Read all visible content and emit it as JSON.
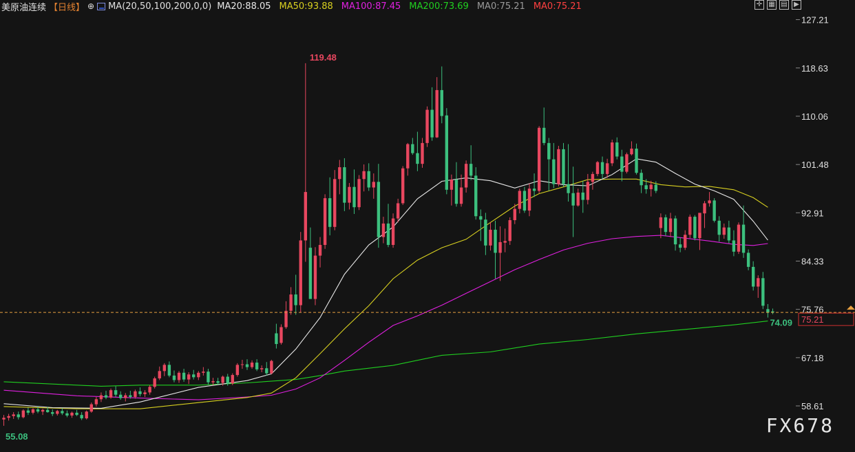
{
  "header": {
    "instrument": "美原油连续",
    "period": "【日线】",
    "ma_params": "MA(20,50,100,200,0,0)",
    "ma_values": [
      {
        "label": "MA20:88.05",
        "color": "#e8e8e8"
      },
      {
        "label": "MA50:93.88",
        "color": "#d8d020"
      },
      {
        "label": "MA100:87.45",
        "color": "#e020e0"
      },
      {
        "label": "MA200:73.69",
        "color": "#20d020"
      },
      {
        "label": "MA0:75.21",
        "color": "#9a9a9a"
      },
      {
        "label": "MA0:75.21",
        "color": "#ff4040"
      }
    ],
    "tools": [
      "crosshair-icon",
      "grid-icon",
      "bars-icon",
      "play-icon"
    ]
  },
  "watermark": "FX678",
  "colors": {
    "background": "#141414",
    "up": "#e8475f",
    "down": "#3cc07e",
    "ma20": "#e8e8e8",
    "ma50": "#d8d020",
    "ma100": "#e020e0",
    "ma200": "#20d020",
    "price_line": "#e8a040"
  },
  "chart_data": {
    "type": "candlestick",
    "y_axis_ticks": [
      "127.21",
      "118.63",
      "110.06",
      "101.48",
      "92.91",
      "84.33",
      "75.76",
      "67.18",
      "58.61"
    ],
    "ylim": [
      52.5,
      128.5
    ],
    "annotations": {
      "max_label": "119.48",
      "min_label": "55.08",
      "ma200_label": "74.09",
      "last_price": "75.21"
    },
    "candles": [
      [
        56.2,
        57.0,
        55.08,
        56.5
      ],
      [
        56.5,
        57.2,
        56.0,
        56.8
      ],
      [
        56.8,
        57.5,
        56.3,
        57.1
      ],
      [
        57.1,
        57.6,
        56.2,
        56.6
      ],
      [
        56.6,
        58.0,
        56.4,
        57.8
      ],
      [
        57.8,
        58.3,
        57.0,
        57.4
      ],
      [
        57.4,
        58.2,
        57.1,
        58.0
      ],
      [
        58.0,
        58.5,
        57.3,
        57.6
      ],
      [
        57.6,
        58.1,
        57.0,
        57.9
      ],
      [
        57.9,
        58.4,
        57.4,
        57.5
      ],
      [
        57.5,
        58.0,
        56.8,
        57.2
      ],
      [
        57.2,
        57.9,
        56.9,
        57.7
      ],
      [
        57.7,
        58.2,
        57.0,
        57.3
      ],
      [
        57.3,
        57.8,
        56.6,
        56.9
      ],
      [
        56.9,
        57.6,
        56.5,
        57.4
      ],
      [
        57.4,
        57.9,
        56.8,
        57.0
      ],
      [
        57.0,
        57.5,
        56.1,
        56.4
      ],
      [
        56.4,
        57.8,
        56.2,
        57.6
      ],
      [
        57.6,
        59.2,
        57.4,
        58.9
      ],
      [
        58.9,
        60.2,
        58.5,
        59.8
      ],
      [
        59.8,
        61.0,
        59.3,
        60.5
      ],
      [
        60.5,
        61.3,
        59.8,
        60.1
      ],
      [
        60.1,
        61.7,
        59.9,
        61.4
      ],
      [
        61.4,
        62.1,
        60.2,
        60.6
      ],
      [
        60.6,
        61.2,
        59.7,
        60.0
      ],
      [
        60.0,
        60.9,
        59.4,
        60.5
      ],
      [
        60.5,
        61.3,
        59.9,
        60.2
      ],
      [
        60.2,
        61.5,
        59.9,
        61.2
      ],
      [
        61.2,
        61.9,
        60.3,
        60.7
      ],
      [
        60.7,
        61.4,
        60.2,
        61.0
      ],
      [
        61.0,
        62.3,
        60.6,
        62.0
      ],
      [
        62.0,
        63.8,
        61.7,
        63.5
      ],
      [
        63.5,
        65.6,
        63.2,
        64.8
      ],
      [
        64.8,
        66.2,
        63.9,
        65.9
      ],
      [
        65.9,
        66.5,
        63.7,
        64.0
      ],
      [
        64.0,
        64.9,
        62.8,
        63.2
      ],
      [
        63.2,
        64.8,
        62.7,
        64.5
      ],
      [
        64.5,
        65.2,
        62.9,
        63.3
      ],
      [
        63.3,
        64.6,
        62.5,
        64.2
      ],
      [
        64.2,
        65.0,
        63.3,
        63.7
      ],
      [
        63.7,
        64.8,
        63.2,
        64.5
      ],
      [
        64.5,
        65.5,
        64.0,
        64.7
      ],
      [
        64.7,
        65.2,
        62.4,
        62.8
      ],
      [
        62.8,
        63.6,
        62.3,
        63.0
      ],
      [
        63.0,
        63.6,
        62.4,
        62.7
      ],
      [
        62.7,
        64.0,
        62.2,
        63.8
      ],
      [
        63.8,
        64.3,
        62.2,
        62.6
      ],
      [
        62.6,
        64.4,
        62.3,
        64.1
      ],
      [
        64.1,
        66.2,
        63.8,
        65.9
      ],
      [
        65.9,
        66.8,
        65.2,
        66.0
      ],
      [
        66.0,
        66.9,
        65.0,
        65.5
      ],
      [
        65.5,
        66.7,
        65.2,
        66.3
      ],
      [
        66.3,
        66.9,
        64.8,
        65.1
      ],
      [
        65.1,
        65.8,
        64.6,
        65.3
      ],
      [
        65.3,
        66.4,
        64.0,
        64.4
      ],
      [
        64.4,
        66.8,
        64.2,
        66.6
      ],
      [
        71.5,
        73.2,
        68.8,
        69.6
      ],
      [
        69.8,
        73.1,
        69.5,
        72.6
      ],
      [
        72.6,
        77.2,
        72.3,
        75.5
      ],
      [
        75.5,
        79.7,
        74.8,
        78.4
      ],
      [
        78.4,
        81.9,
        74.8,
        76.5
      ],
      [
        76.5,
        89.5,
        75.2,
        88.0
      ],
      [
        88.0,
        119.48,
        84.2,
        96.6
      ],
      [
        86.7,
        90.3,
        82.2,
        77.6
      ],
      [
        77.6,
        86.8,
        76.5,
        85.3
      ],
      [
        85.3,
        88.6,
        83.2,
        87.2
      ],
      [
        87.2,
        96.2,
        86.5,
        95.5
      ],
      [
        95.5,
        99.2,
        88.9,
        90.4
      ],
      [
        90.4,
        100.5,
        89.8,
        98.9
      ],
      [
        98.9,
        102.3,
        96.2,
        101.0
      ],
      [
        101.0,
        102.6,
        93.2,
        94.7
      ],
      [
        94.7,
        98.2,
        93.5,
        97.5
      ],
      [
        97.5,
        100.6,
        92.7,
        93.9
      ],
      [
        93.9,
        99.6,
        93.4,
        98.9
      ],
      [
        98.9,
        101.5,
        96.7,
        100.3
      ],
      [
        100.3,
        101.7,
        96.8,
        97.4
      ],
      [
        97.4,
        99.9,
        95.4,
        98.4
      ],
      [
        98.4,
        101.6,
        86.7,
        88.6
      ],
      [
        88.6,
        92.2,
        87.5,
        91.0
      ],
      [
        91.0,
        94.5,
        86.8,
        87.2
      ],
      [
        87.2,
        92.8,
        86.7,
        91.9
      ],
      [
        91.9,
        95.4,
        91.2,
        94.6
      ],
      [
        94.6,
        101.2,
        94.3,
        100.8
      ],
      [
        100.8,
        105.3,
        99.5,
        105.1
      ],
      [
        105.1,
        106.2,
        103.2,
        103.5
      ],
      [
        103.5,
        107.3,
        100.3,
        101.6
      ],
      [
        101.6,
        106.2,
        100.9,
        105.3
      ],
      [
        105.3,
        111.8,
        104.6,
        111.2
      ],
      [
        111.2,
        115.2,
        105.7,
        106.3
      ],
      [
        106.3,
        117.0,
        106.2,
        114.7
      ],
      [
        114.7,
        118.9,
        108.8,
        110.1
      ],
      [
        110.2,
        111.5,
        96.2,
        97.0
      ],
      [
        97.0,
        99.7,
        94.2,
        98.8
      ],
      [
        98.8,
        101.9,
        94.0,
        94.5
      ],
      [
        94.5,
        99.7,
        94.0,
        97.4
      ],
      [
        97.4,
        102.2,
        96.5,
        101.6
      ],
      [
        101.6,
        104.9,
        98.7,
        99.5
      ],
      [
        99.5,
        101.0,
        91.7,
        92.3
      ],
      [
        92.3,
        93.5,
        87.9,
        91.7
      ],
      [
        91.7,
        92.9,
        85.4,
        87.1
      ],
      [
        87.1,
        91.2,
        86.2,
        89.9
      ],
      [
        89.9,
        91.5,
        81.2,
        85.8
      ],
      [
        85.8,
        90.5,
        80.8,
        87.7
      ],
      [
        87.6,
        90.1,
        85.9,
        87.9
      ],
      [
        87.9,
        92.1,
        87.2,
        91.6
      ],
      [
        91.6,
        94.5,
        90.9,
        93.6
      ],
      [
        93.6,
        97.2,
        92.8,
        96.8
      ],
      [
        96.8,
        97.5,
        92.9,
        93.3
      ],
      [
        93.3,
        98.1,
        92.3,
        97.2
      ],
      [
        97.2,
        99.9,
        95.7,
        96.8
      ],
      [
        96.8,
        108.3,
        96.4,
        108.0
      ],
      [
        108.0,
        111.6,
        104.9,
        105.3
      ],
      [
        105.3,
        106.2,
        96.8,
        102.4
      ],
      [
        102.4,
        105.3,
        97.3,
        98.0
      ],
      [
        98.0,
        104.8,
        97.6,
        104.2
      ],
      [
        104.2,
        105.3,
        97.5,
        98.0
      ],
      [
        98.0,
        105.1,
        94.9,
        96.4
      ],
      [
        96.4,
        101.1,
        88.6,
        94.2
      ],
      [
        94.2,
        97.2,
        94.0,
        96.5
      ],
      [
        96.5,
        98.6,
        92.9,
        95.2
      ],
      [
        95.2,
        99.8,
        94.4,
        98.4
      ],
      [
        98.4,
        100.2,
        97.0,
        99.8
      ],
      [
        99.8,
        102.1,
        99.4,
        101.9
      ],
      [
        101.9,
        102.9,
        99.0,
        99.8
      ],
      [
        99.8,
        102.5,
        99.1,
        101.7
      ],
      [
        101.7,
        105.9,
        101.2,
        105.4
      ],
      [
        105.4,
        106.3,
        102.4,
        102.9
      ],
      [
        102.9,
        104.1,
        98.5,
        100.2
      ],
      [
        100.2,
        103.6,
        99.9,
        103.3
      ],
      [
        103.3,
        105.6,
        103.1,
        104.3
      ],
      [
        104.3,
        105.2,
        99.7,
        100.0
      ],
      [
        100.0,
        100.6,
        96.4,
        97.8
      ],
      [
        97.8,
        98.9,
        96.3,
        97.1
      ],
      [
        97.1,
        98.6,
        95.8,
        97.9
      ],
      [
        97.9,
        98.5,
        96.4,
        96.8
      ],
      [
        90.2,
        92.8,
        88.4,
        92.1
      ],
      [
        92.1,
        92.6,
        88.8,
        89.5
      ],
      [
        89.5,
        92.9,
        88.6,
        91.9
      ],
      [
        91.9,
        92.4,
        86.2,
        87.3
      ],
      [
        87.3,
        88.5,
        85.9,
        86.7
      ],
      [
        86.7,
        89.8,
        86.3,
        89.0
      ],
      [
        89.0,
        92.6,
        88.4,
        92.2
      ],
      [
        92.2,
        92.5,
        88.0,
        88.4
      ],
      [
        88.4,
        91.3,
        86.3,
        92.9
      ],
      [
        92.8,
        95.0,
        90.2,
        94.6
      ],
      [
        94.6,
        96.6,
        94.0,
        95.1
      ],
      [
        95.1,
        95.5,
        91.2,
        91.5
      ],
      [
        91.5,
        92.3,
        87.8,
        89.0
      ],
      [
        89.0,
        91.0,
        88.3,
        90.3
      ],
      [
        90.3,
        91.5,
        87.5,
        88.0
      ],
      [
        88.0,
        89.8,
        85.2,
        86.0
      ],
      [
        86.0,
        91.2,
        85.6,
        90.8
      ],
      [
        90.8,
        94.2,
        84.9,
        85.8
      ],
      [
        85.8,
        86.4,
        82.7,
        83.3
      ],
      [
        83.3,
        84.3,
        79.1,
        79.8
      ],
      [
        79.8,
        81.8,
        77.8,
        81.3
      ],
      [
        81.3,
        82.4,
        75.8,
        76.4
      ],
      [
        75.8,
        76.7,
        74.3,
        75.2
      ],
      [
        75.4,
        75.9,
        74.9,
        75.21
      ]
    ],
    "ma20": [
      [
        0,
        59.0
      ],
      [
        10,
        58.3
      ],
      [
        20,
        58.2
      ],
      [
        28,
        59.3
      ],
      [
        40,
        61.9
      ],
      [
        50,
        63.1
      ],
      [
        55,
        64.3
      ],
      [
        60,
        68.7
      ],
      [
        65,
        74.3
      ],
      [
        70,
        82.0
      ],
      [
        75,
        87.2
      ],
      [
        80,
        90.4
      ],
      [
        85,
        95.4
      ],
      [
        90,
        98.5
      ],
      [
        95,
        99.1
      ],
      [
        100,
        98.6
      ],
      [
        105,
        97.3
      ],
      [
        110,
        98.6
      ],
      [
        115,
        97.9
      ],
      [
        120,
        97.7
      ],
      [
        125,
        99.7
      ],
      [
        130,
        102.5
      ],
      [
        134,
        101.9
      ],
      [
        138,
        99.9
      ],
      [
        142,
        98.0
      ],
      [
        146,
        96.8
      ],
      [
        150,
        95.3
      ],
      [
        154,
        91.4
      ],
      [
        157,
        88.05
      ]
    ],
    "ma50": [
      [
        0,
        58.5
      ],
      [
        15,
        58.1
      ],
      [
        28,
        58.1
      ],
      [
        40,
        59.2
      ],
      [
        50,
        60.1
      ],
      [
        55,
        60.9
      ],
      [
        60,
        63.6
      ],
      [
        65,
        67.9
      ],
      [
        70,
        72.3
      ],
      [
        75,
        76.4
      ],
      [
        80,
        81.2
      ],
      [
        85,
        84.5
      ],
      [
        90,
        86.7
      ],
      [
        95,
        88.2
      ],
      [
        100,
        91.2
      ],
      [
        105,
        94.1
      ],
      [
        110,
        96.3
      ],
      [
        115,
        97.5
      ],
      [
        120,
        98.8
      ],
      [
        125,
        98.9
      ],
      [
        130,
        98.9
      ],
      [
        135,
        97.9
      ],
      [
        140,
        97.5
      ],
      [
        145,
        97.6
      ],
      [
        150,
        97.0
      ],
      [
        154,
        95.6
      ],
      [
        157,
        93.88
      ]
    ],
    "ma100": [
      [
        0,
        61.4
      ],
      [
        15,
        60.4
      ],
      [
        28,
        60.0
      ],
      [
        40,
        59.7
      ],
      [
        50,
        60.2
      ],
      [
        55,
        60.5
      ],
      [
        60,
        61.6
      ],
      [
        65,
        63.6
      ],
      [
        70,
        66.7
      ],
      [
        75,
        69.9
      ],
      [
        80,
        72.9
      ],
      [
        85,
        74.6
      ],
      [
        90,
        76.5
      ],
      [
        95,
        78.6
      ],
      [
        100,
        80.7
      ],
      [
        105,
        82.8
      ],
      [
        110,
        84.6
      ],
      [
        115,
        86.3
      ],
      [
        120,
        87.5
      ],
      [
        125,
        88.3
      ],
      [
        130,
        88.7
      ],
      [
        135,
        88.9
      ],
      [
        140,
        88.4
      ],
      [
        145,
        87.9
      ],
      [
        150,
        87.3
      ],
      [
        154,
        87.1
      ],
      [
        157,
        87.45
      ]
    ],
    "ma200": [
      [
        0,
        62.9
      ],
      [
        20,
        62.1
      ],
      [
        28,
        62.3
      ],
      [
        40,
        62.3
      ],
      [
        50,
        62.7
      ],
      [
        60,
        63.3
      ],
      [
        65,
        64.0
      ],
      [
        70,
        64.8
      ],
      [
        80,
        65.8
      ],
      [
        90,
        67.6
      ],
      [
        100,
        68.2
      ],
      [
        110,
        69.6
      ],
      [
        120,
        70.4
      ],
      [
        130,
        71.4
      ],
      [
        140,
        72.2
      ],
      [
        150,
        73.0
      ],
      [
        157,
        73.69
      ]
    ]
  }
}
